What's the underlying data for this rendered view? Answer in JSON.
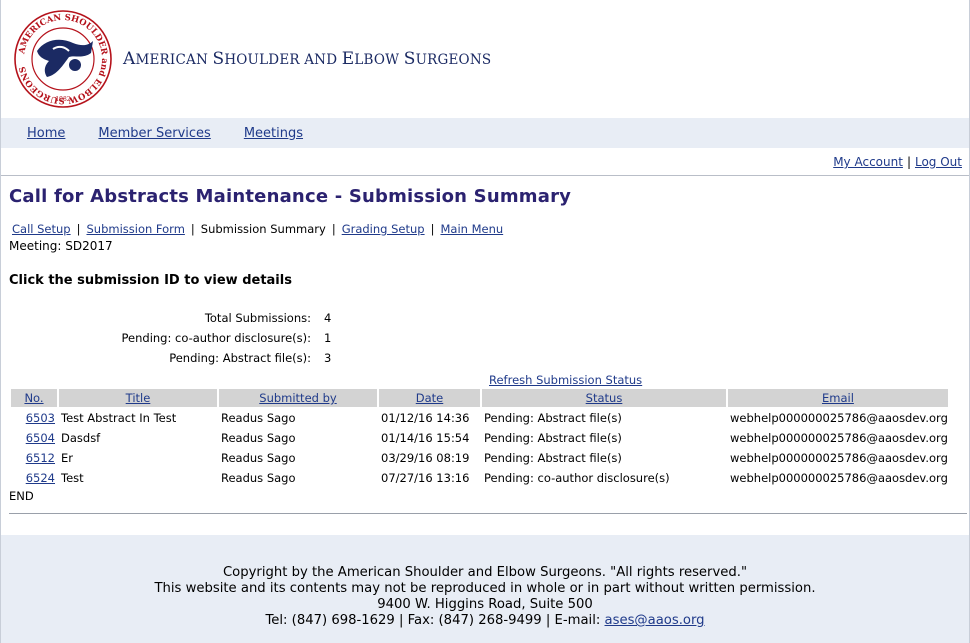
{
  "header": {
    "org_name_parts": [
      {
        "big": "A",
        "small": "MERICAN "
      },
      {
        "big": "S",
        "small": "HOULDER AND "
      },
      {
        "big": "E",
        "small": "LBOW "
      },
      {
        "big": "S",
        "small": "URGEONS"
      }
    ],
    "logo_text": "AMERICAN SHOULDER and ELBOW SURGEONS",
    "logo_year": "1982"
  },
  "nav": {
    "items": [
      "Home",
      "Member Services",
      "Meetings"
    ]
  },
  "account": {
    "my_account": "My Account",
    "separator": "|",
    "log_out": "Log Out"
  },
  "page": {
    "title": "Call for Abstracts Maintenance - Submission Summary",
    "subnav": {
      "call_setup": "Call Setup",
      "submission_form": "Submission Form",
      "submission_summary": "Submission Summary",
      "grading_setup": "Grading Setup",
      "main_menu": "Main Menu",
      "separator": "|"
    },
    "meeting": "Meeting: SD2017",
    "instruction": "Click the submission ID to view details"
  },
  "stats": [
    {
      "label": "Total Submissions:",
      "value": "4"
    },
    {
      "label": "Pending: co-author disclosure(s):",
      "value": "1"
    },
    {
      "label": "Pending: Abstract file(s):",
      "value": "3"
    }
  ],
  "refresh_label": "Refresh Submission Status",
  "table": {
    "headers": [
      "No.",
      "Title",
      "Submitted by",
      "Date",
      "Status",
      "Email"
    ],
    "rows": [
      {
        "no": "6503",
        "title": "Test Abstract In Test",
        "submitted_by": "Readus Sago",
        "date": "01/12/16 14:36",
        "status": "Pending: Abstract file(s)",
        "email": "webhelp000000025786@aaosdev.org"
      },
      {
        "no": "6504",
        "title": "Dasdsf",
        "submitted_by": "Readus Sago",
        "date": "01/14/16 15:54",
        "status": "Pending: Abstract file(s)",
        "email": "webhelp000000025786@aaosdev.org"
      },
      {
        "no": "6512",
        "title": "Er",
        "submitted_by": "Readus Sago",
        "date": "03/29/16 08:19",
        "status": "Pending: Abstract file(s)",
        "email": "webhelp000000025786@aaosdev.org"
      },
      {
        "no": "6524",
        "title": "Test",
        "submitted_by": "Readus Sago",
        "date": "07/27/16 13:16",
        "status": "Pending: co-author disclosure(s)",
        "email": "webhelp000000025786@aaosdev.org"
      }
    ],
    "end_label": "END"
  },
  "footer": {
    "copyright": "Copyright by the American Shoulder and Elbow Surgeons. \"All rights reserved.\"",
    "notice": "This website and its contents may not be reproduced in whole or in part without written permission.",
    "address": "9400 W. Higgins Road, Suite 500",
    "contact_prefix": "Tel: (847) 698-1629 | Fax: (847) 268-9499 | E-mail: ",
    "email": "ases@aaos.org"
  },
  "colors": {
    "brand_navy": "#1b2a63",
    "title_purple": "#2b2270",
    "link_blue": "#1f3a8a",
    "nav_bg": "#e8edf5",
    "header_cell_bg": "#d3d3d3",
    "logo_red": "#b5121b"
  }
}
